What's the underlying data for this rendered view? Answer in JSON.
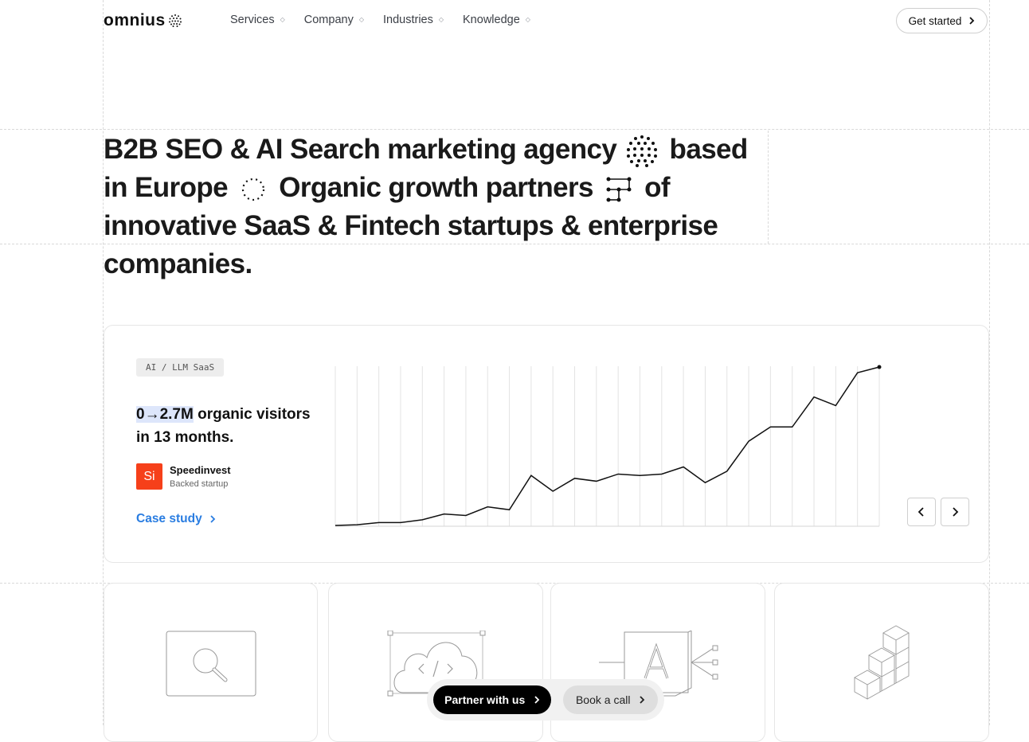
{
  "header": {
    "logo_text": "omnius",
    "nav": [
      "Services",
      "Company",
      "Industries",
      "Knowledge"
    ],
    "cta": "Get started"
  },
  "hero": {
    "part1": "B2B SEO & AI Search marketing agency",
    "part2": "based in Europe",
    "part3": "Organic growth partners",
    "part4": "of innovative SaaS & Fintech startups & enterprise companies."
  },
  "case_study": {
    "tag": "AI / LLM SaaS",
    "stat_highlight": "0→2.7M",
    "stat_rest": "organic visitors in 13 months.",
    "brand_initials": "Si",
    "brand_name": "Speedinvest",
    "brand_sub": "Backed startup",
    "link": "Case study",
    "chart_data": {
      "type": "line",
      "values": [
        0,
        0.5,
        2,
        2,
        4,
        8,
        7,
        13,
        11,
        35,
        24,
        33,
        31,
        36,
        35,
        36,
        41,
        30,
        38,
        59,
        69,
        69,
        90,
        84,
        107,
        111
      ]
    }
  },
  "cta_bar": {
    "primary": "Partner with us",
    "secondary": "Book a call"
  },
  "colors": {
    "accent_link": "#2a7de1",
    "brand_logo": "#f6401a",
    "highlight": "#dde6fb"
  }
}
